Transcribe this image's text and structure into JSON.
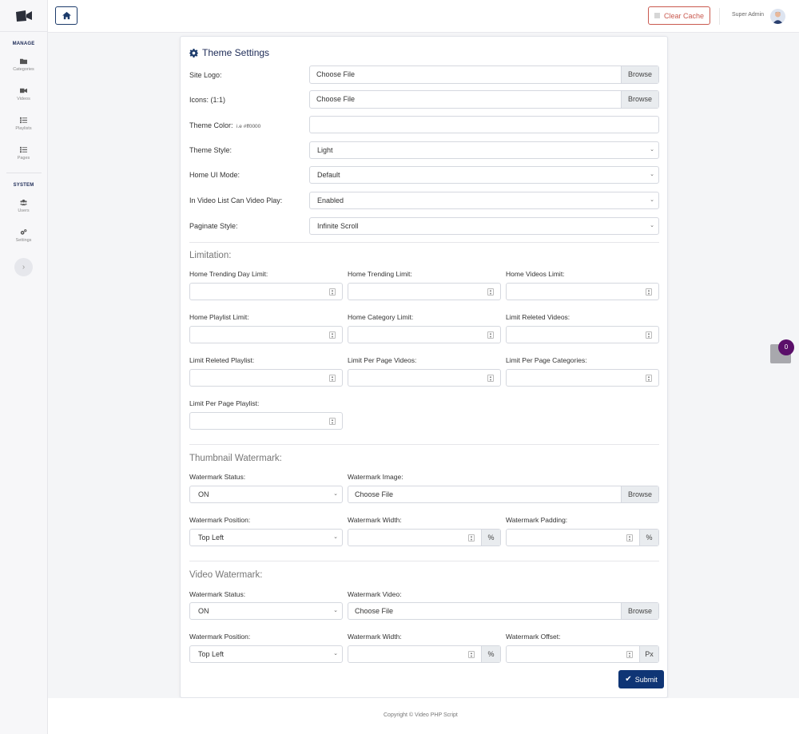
{
  "sidebar": {
    "manage_heading": "MANAGE",
    "system_heading": "SYSTEM",
    "items": [
      {
        "label": "Categories",
        "icon": "folder-icon"
      },
      {
        "label": "Videos",
        "icon": "video-icon"
      },
      {
        "label": "Playlists",
        "icon": "list-icon"
      },
      {
        "label": "Pages",
        "icon": "list-icon"
      },
      {
        "label": "Users",
        "icon": "users-icon"
      },
      {
        "label": "Settings",
        "icon": "gears-icon"
      }
    ],
    "toggle_glyph": "›"
  },
  "header": {
    "clear_cache_label": "Clear Cache",
    "user_name": "Super Admin"
  },
  "card": {
    "title": "Theme Settings",
    "site_logo_label": "Site Logo:",
    "icons_label": "Icons: (1:1)",
    "theme_color_label": "Theme Color:",
    "theme_color_hint": "i.e #ff0000",
    "theme_style_label": "Theme Style:",
    "theme_style_value": "Light",
    "home_ui_label": "Home UI Mode:",
    "home_ui_value": "Default",
    "video_play_label": "In Video List Can Video Play:",
    "video_play_value": "Enabled",
    "paginate_label": "Paginate Style:",
    "paginate_value": "Infinite Scroll",
    "choose_file": "Choose File",
    "browse": "Browse"
  },
  "limitation": {
    "title": "Limitation:",
    "fields": [
      "Home Trending Day Limit:",
      "Home Trending Limit:",
      "Home Videos Limit:",
      "Home Playlist Limit:",
      "Home Category Limit:",
      "Limit Releted Videos:",
      "Limit Releted Playlist:",
      "Limit Per Page Videos:",
      "Limit Per Page Categories:",
      "Limit Per Page Playlist:"
    ]
  },
  "thumb_watermark": {
    "title": "Thumbnail Watermark:",
    "status_label": "Watermark Status:",
    "status_value": "ON",
    "image_label": "Watermark Image:",
    "position_label": "Watermark Position:",
    "position_value": "Top Left",
    "width_label": "Watermark Width:",
    "width_unit": "%",
    "padding_label": "Watermark Padding:",
    "padding_unit": "%"
  },
  "video_watermark": {
    "title": "Video Watermark:",
    "status_label": "Watermark Status:",
    "status_value": "ON",
    "video_label": "Watermark Video:",
    "position_label": "Watermark Position:",
    "position_value": "Top Left",
    "width_label": "Watermark Width:",
    "width_unit": "%",
    "offset_label": "Watermark Offset:",
    "offset_unit": "Px"
  },
  "submit_label": "Submit",
  "footer_text": "Copyright © Video PHP Script",
  "notification_count": "0",
  "colors": {
    "brand_navy": "#1c3b6b",
    "submit": "#0f3575",
    "clear_cache": "#c9594f",
    "badge": "#5b0f6a"
  }
}
